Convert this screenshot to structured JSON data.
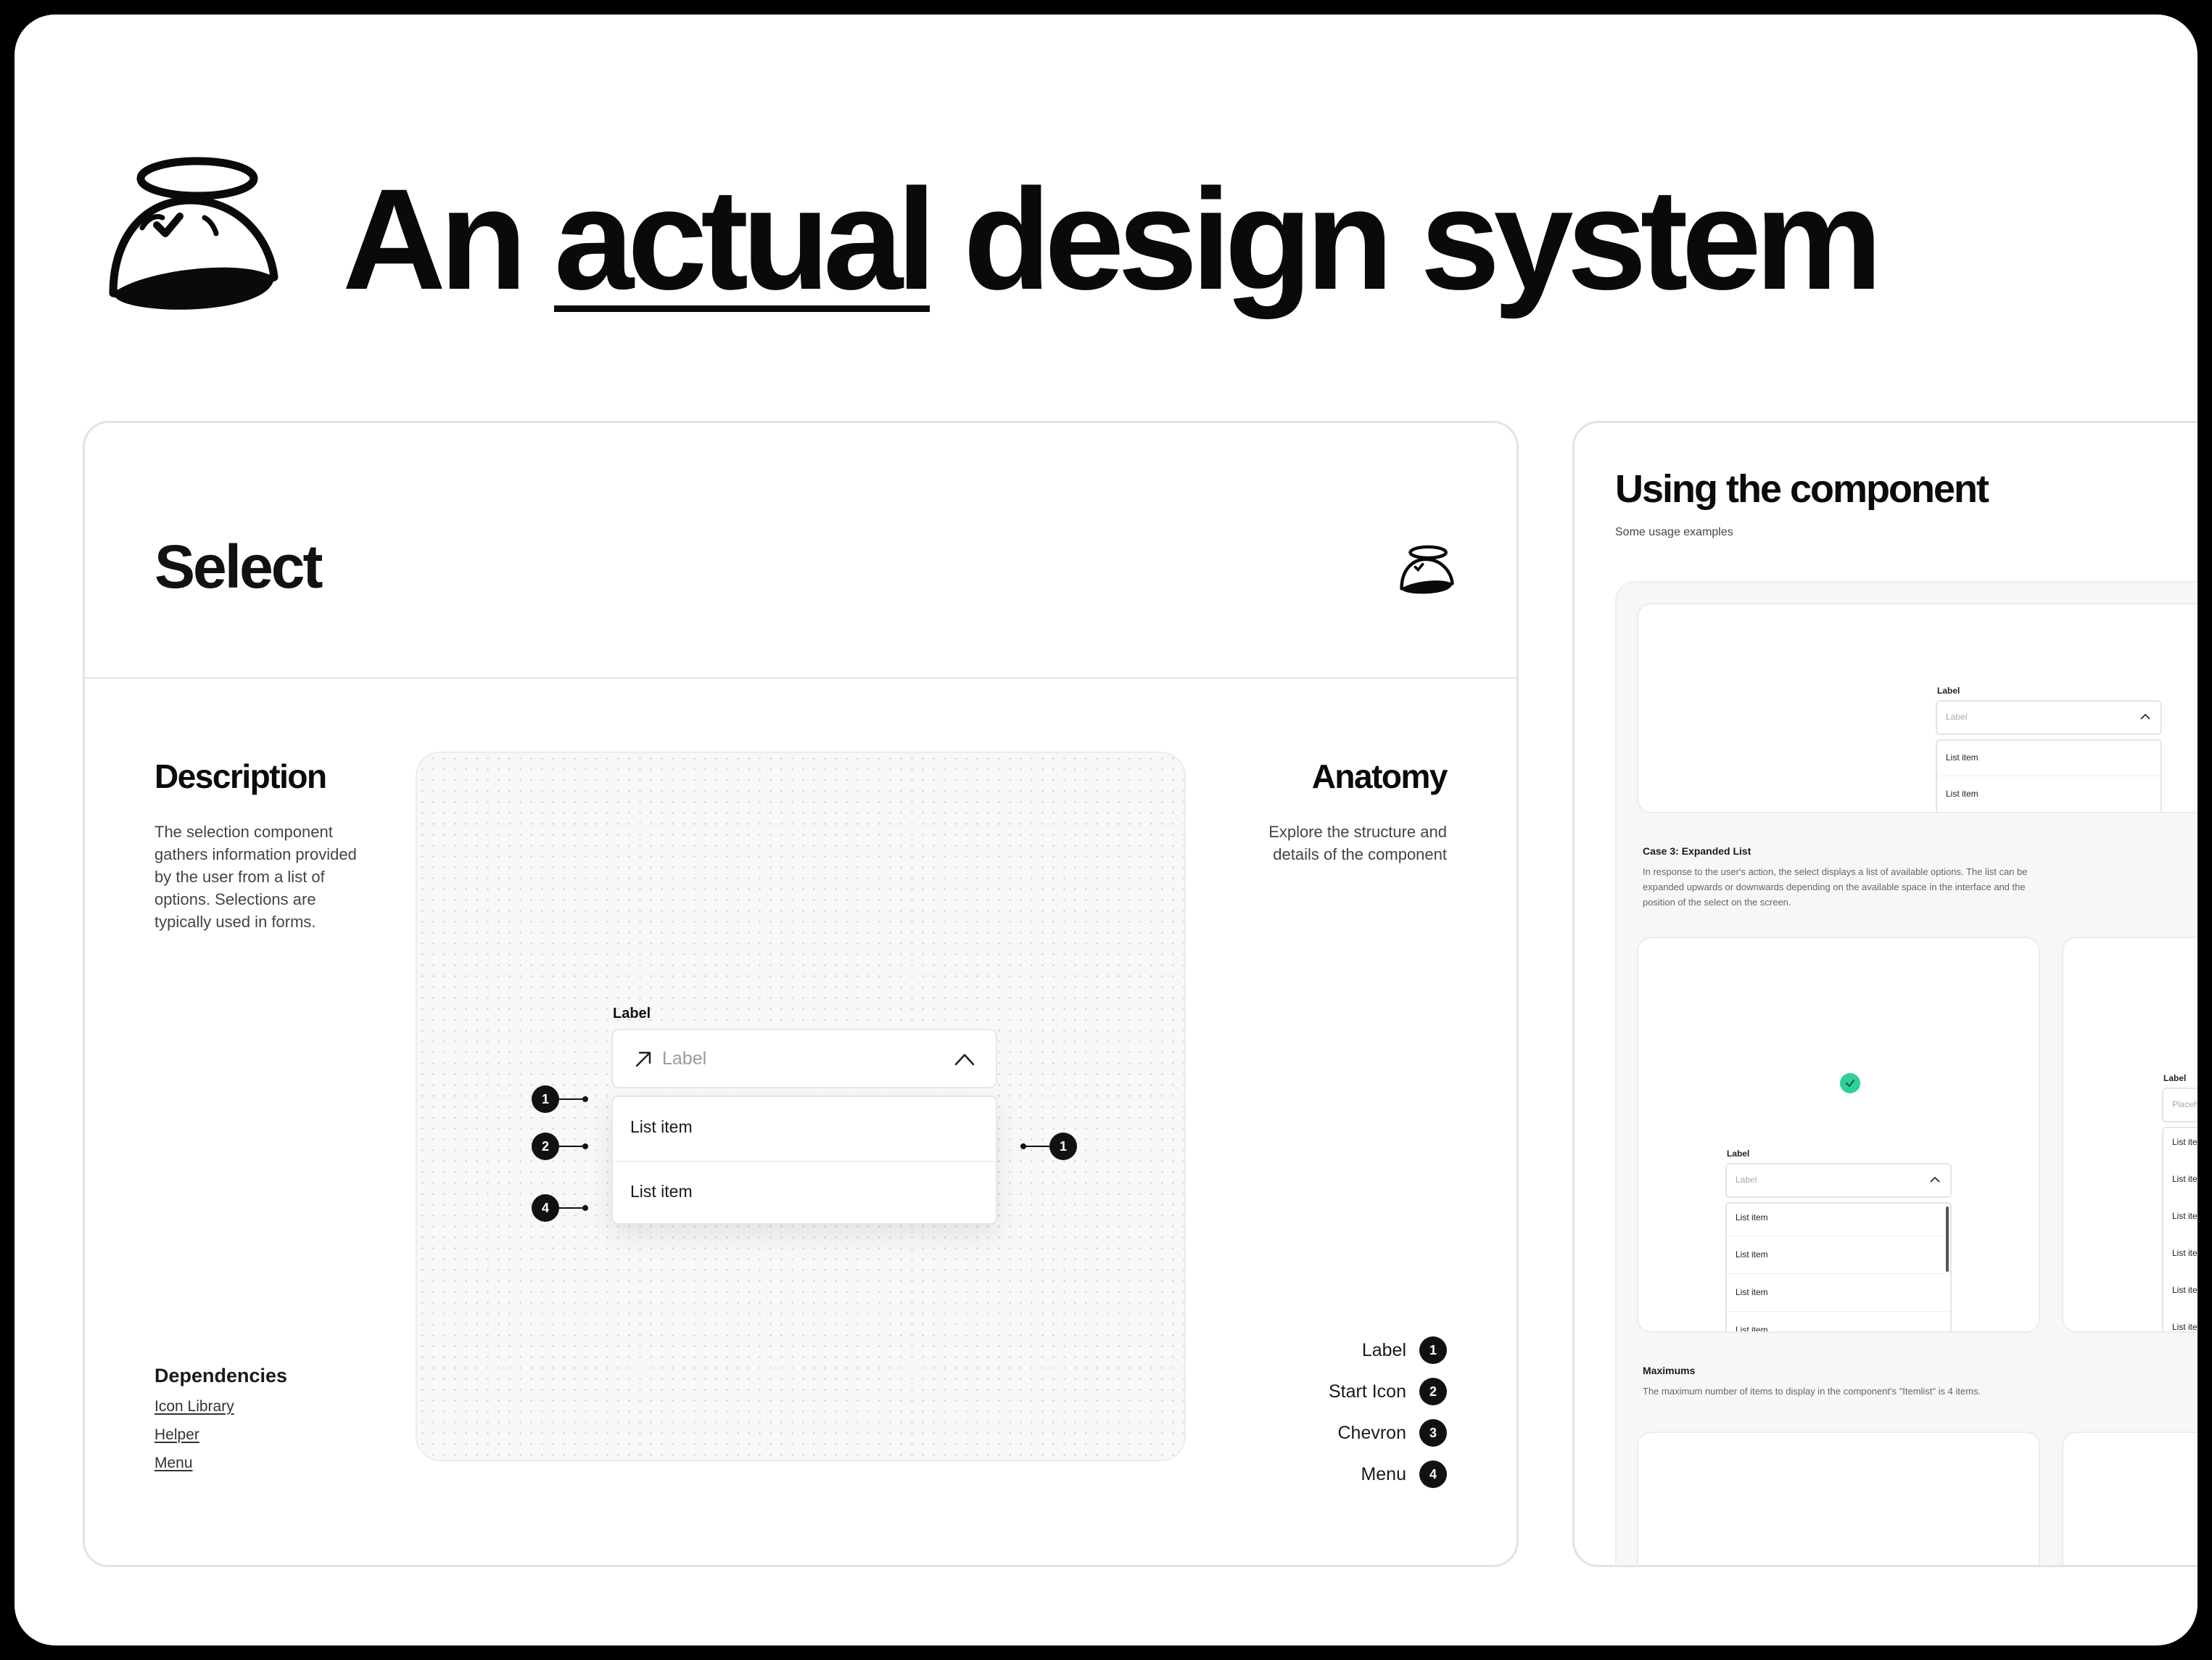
{
  "hero": {
    "title_pre": "An",
    "title_emph": "actual",
    "title_post": "design system",
    "logo_icon": "halo-dome-mascot-icon"
  },
  "select_card": {
    "title": "Select",
    "logo_icon": "halo-dome-mascot-icon",
    "description": {
      "title": "Description",
      "text": "The selection component gathers information provided by the user from a list of options. Selections are typically used in forms."
    },
    "dependencies": {
      "title": "Dependencies",
      "links": [
        "Icon Library",
        "Helper",
        "Menu"
      ]
    },
    "anatomy": {
      "title": "Anatomy",
      "text": "Explore the structure and details of the component",
      "legend": [
        {
          "label": "Label",
          "num": "1"
        },
        {
          "label": "Start Icon",
          "num": "2"
        },
        {
          "label": "Chevron",
          "num": "3"
        },
        {
          "label": "Menu",
          "num": "4"
        }
      ]
    },
    "demo": {
      "label": "Label",
      "placeholder": "Label",
      "start_icon": "arrow-up-right-icon",
      "chevron_icon": "chevron-up-icon",
      "items": [
        "List item",
        "List item"
      ],
      "markers": [
        "1",
        "2",
        "4",
        "1"
      ]
    }
  },
  "usage_card": {
    "title": "Using the component",
    "subtitle": "Some usage examples",
    "example1": {
      "label": "Label",
      "placeholder": "Label",
      "items": [
        "List item",
        "List item"
      ]
    },
    "case3": {
      "heading": "Case 3: Expanded List",
      "text": "In response to the user's action, the select displays a list of available options. The list can be expanded upwards or downwards depending on the available space in the interface and the position of the select on the screen."
    },
    "example2": {
      "label": "Label",
      "placeholder": "Label",
      "items": [
        "List item",
        "List item",
        "List item",
        "List item"
      ]
    },
    "example3": {
      "label": "Label",
      "placeholder": "Placeho",
      "items": [
        "List item",
        "List item",
        "List item",
        "List item",
        "List item",
        "List item"
      ]
    },
    "maximums": {
      "heading": "Maximums",
      "text": "The maximum number of items to display in the component's \"Itemlist\" is 4 items."
    },
    "colors": {
      "check": "#2fcf9a"
    }
  }
}
